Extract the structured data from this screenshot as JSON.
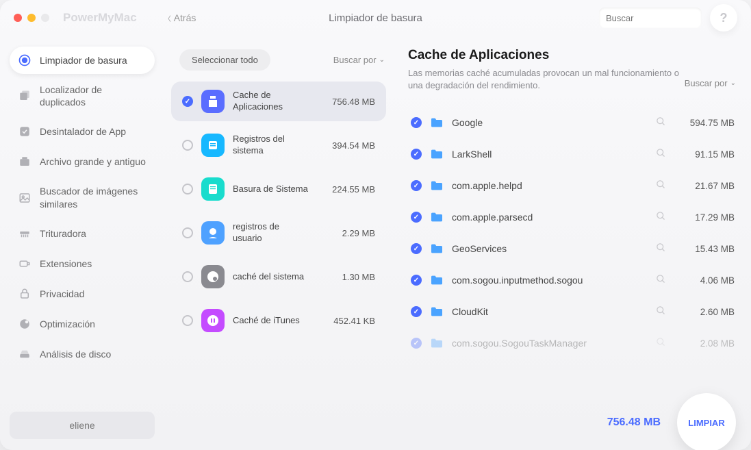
{
  "app_name": "PowerMyMac",
  "back_label": "Atrás",
  "page_title": "Limpiador de basura",
  "search_placeholder": "Buscar",
  "help_label": "?",
  "sidebar": {
    "items": [
      {
        "label": "Limpiador de basura",
        "icon": "cleaner",
        "active": true
      },
      {
        "label": "Localizador de duplicados",
        "icon": "duplicate",
        "active": false
      },
      {
        "label": "Desintalador de App",
        "icon": "uninstaller",
        "active": false
      },
      {
        "label": "Archivo grande y antiguo",
        "icon": "large-old",
        "active": false
      },
      {
        "label": "Buscador de imágenes similares",
        "icon": "images",
        "active": false
      },
      {
        "label": "Trituradora",
        "icon": "shredder",
        "active": false
      },
      {
        "label": "Extensiones",
        "icon": "extensions",
        "active": false
      },
      {
        "label": "Privacidad",
        "icon": "privacy",
        "active": false
      },
      {
        "label": "Optimización",
        "icon": "optimize",
        "active": false
      },
      {
        "label": "Análisis de disco",
        "icon": "disk",
        "active": false
      }
    ],
    "user": "eliene"
  },
  "middle": {
    "select_all": "Seleccionar todo",
    "sort_label": "Buscar por",
    "categories": [
      {
        "name": "Cache de Aplicaciones",
        "size": "756.48 MB",
        "selected": true,
        "checked": true,
        "color": "#5a6dff"
      },
      {
        "name": "Registros del sistema",
        "size": "394.54 MB",
        "selected": false,
        "checked": false,
        "color": "#17b8ff"
      },
      {
        "name": "Basura de Sistema",
        "size": "224.55 MB",
        "selected": false,
        "checked": false,
        "color": "#19dccd"
      },
      {
        "name": "registros de usuario",
        "size": "2.29 MB",
        "selected": false,
        "checked": false,
        "color": "#4ea1ff"
      },
      {
        "name": "caché del sistema",
        "size": "1.30 MB",
        "selected": false,
        "checked": false,
        "color": "#8a8a90"
      },
      {
        "name": "Caché de iTunes",
        "size": "452.41 KB",
        "selected": false,
        "checked": false,
        "color": "#c44bff"
      }
    ]
  },
  "right": {
    "title": "Cache de Aplicaciones",
    "description": "Las memorias caché acumuladas provocan un mal funcionamiento o una degradación del rendimiento.",
    "sort_label": "Buscar por",
    "items": [
      {
        "name": "Google",
        "size": "594.75 MB"
      },
      {
        "name": "LarkShell",
        "size": "91.15 MB"
      },
      {
        "name": "com.apple.helpd",
        "size": "21.67 MB"
      },
      {
        "name": "com.apple.parsecd",
        "size": "17.29 MB"
      },
      {
        "name": "GeoServices",
        "size": "15.43 MB"
      },
      {
        "name": "com.sogou.inputmethod.sogou",
        "size": "4.06 MB"
      },
      {
        "name": "CloudKit",
        "size": "2.60 MB"
      },
      {
        "name": "com.sogou.SogouTaskManager",
        "size": "2.08 MB"
      }
    ]
  },
  "footer": {
    "total": "756.48 MB",
    "clean": "LIMPIAR"
  }
}
